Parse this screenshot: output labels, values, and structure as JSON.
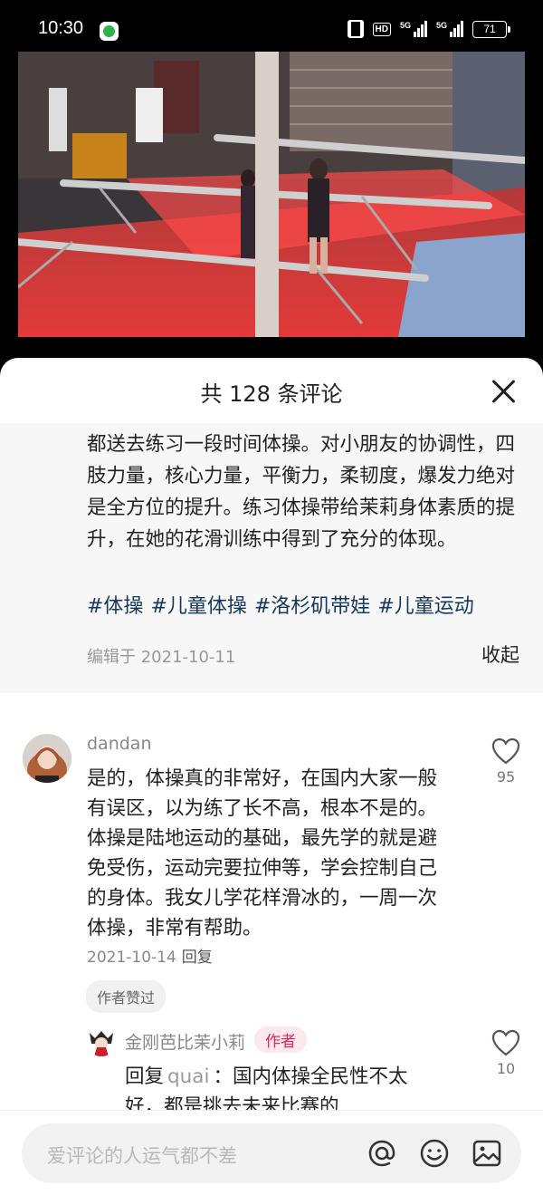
{
  "status_bar": {
    "time": "10:30",
    "hd": "HD",
    "signal1": "5G",
    "signal2": "5G",
    "battery": "71",
    "app_icon": "wechat-icon"
  },
  "video": {
    "icon": "gymnastics-video-frame"
  },
  "sheet": {
    "title": "共 128 条评论",
    "close_icon": "close-icon"
  },
  "description": {
    "text": "都送去练习一段时间体操。对小朋友的协调性，四肢力量，核心力量，平衡力，柔韧度，爆发力绝对是全方位的提升。练习体操带给茉莉身体素质的提升，在她的花滑训练中得到了充分的体现。",
    "tags": [
      "#体操",
      "#儿童体操",
      "#洛杉矶带娃",
      "#儿童运动"
    ],
    "edit_date": "编辑于 2021-10-11",
    "collapse": "收起"
  },
  "comments": [
    {
      "user": "dandan",
      "text": "是的，体操真的非常好，在国内大家一般有误区，以为练了长不高，根本不是的。体操是陆地运动的基础，最先学的就是避免受伤，运动完要拉伸等，学会控制自己的身体。我女儿学花样滑冰的，一周一次体操，非常有帮助。",
      "date": "2021-10-14",
      "reply_label": "回复",
      "likes": "95",
      "author_liked": "作者赞过",
      "reply": {
        "user": "金刚芭比茉小莉",
        "badge": "作者",
        "prefix": "回复",
        "reply_to": "quai",
        "text": "：国内体操全民性不太好，都是挑去未来比赛的",
        "likes": "10"
      }
    }
  ],
  "input": {
    "placeholder": "爱评论的人运气都不差",
    "icons": [
      "at-icon",
      "emoji-icon",
      "image-icon"
    ]
  },
  "colors": {
    "tag": "#14385c",
    "badge_bg": "#fde9ec",
    "badge_text": "#e0245e",
    "sheet_bg": "#ffffff",
    "desc_bg": "#f7f7f7"
  }
}
